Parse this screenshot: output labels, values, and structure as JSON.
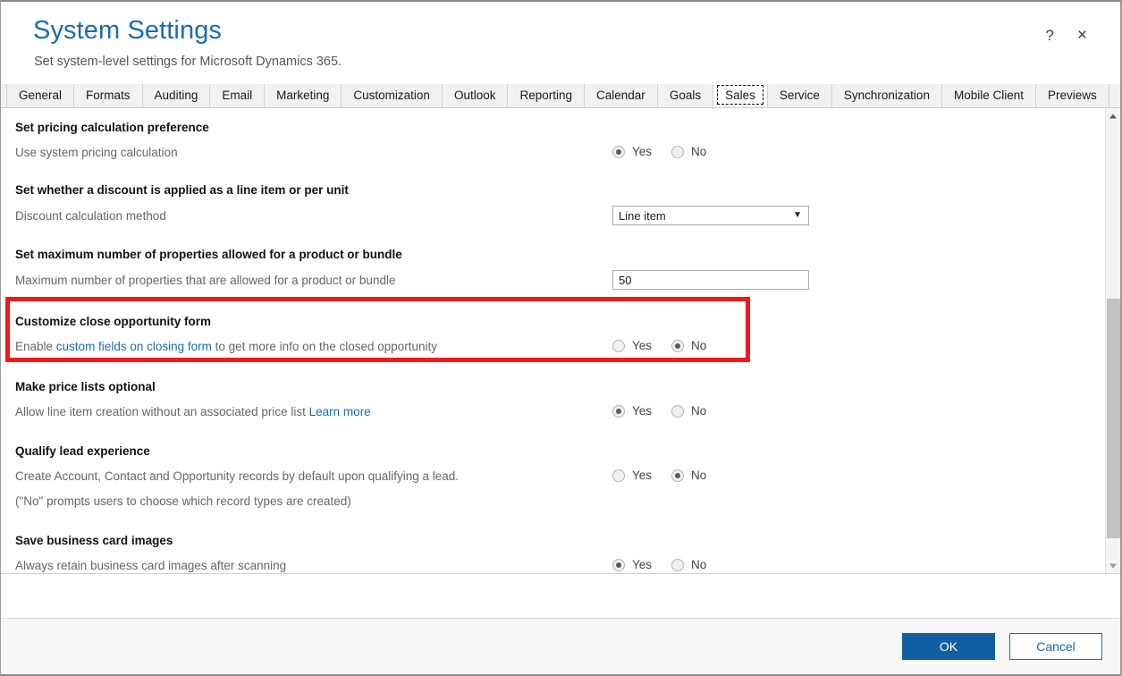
{
  "window": {
    "title": "System Settings",
    "subtitle": "Set system-level settings for Microsoft Dynamics 365.",
    "help_icon": "?",
    "close_icon": "×"
  },
  "colors": {
    "title_blue": "#1a6bb5",
    "link_blue": "#1a6bb5",
    "primary_button": "#115ea3",
    "highlight_red": "#ee1b1b"
  },
  "tabs": [
    {
      "label": "General",
      "active": false
    },
    {
      "label": "Formats",
      "active": false
    },
    {
      "label": "Auditing",
      "active": false
    },
    {
      "label": "Email",
      "active": false
    },
    {
      "label": "Marketing",
      "active": false
    },
    {
      "label": "Customization",
      "active": false
    },
    {
      "label": "Outlook",
      "active": false
    },
    {
      "label": "Reporting",
      "active": false
    },
    {
      "label": "Calendar",
      "active": false
    },
    {
      "label": "Goals",
      "active": false
    },
    {
      "label": "Sales",
      "active": true
    },
    {
      "label": "Service",
      "active": false
    },
    {
      "label": "Synchronization",
      "active": false
    },
    {
      "label": "Mobile Client",
      "active": false
    },
    {
      "label": "Previews",
      "active": false
    }
  ],
  "radio_options": {
    "yes": "Yes",
    "no": "No"
  },
  "sections": {
    "pricing": {
      "title": "Set pricing calculation preference",
      "description": "Use system pricing calculation",
      "selected": "Yes"
    },
    "discount": {
      "title": "Set whether a discount is applied as a line item or per unit",
      "description": "Discount calculation method",
      "dropdown_value": "Line item",
      "dropdown_caret": "▼"
    },
    "max_properties": {
      "title": "Set maximum number of properties allowed for a product or bundle",
      "description": "Maximum number of properties that are allowed for a product or bundle",
      "value": "50"
    },
    "close_opportunity": {
      "title": "Customize close opportunity form",
      "description_before": "Enable ",
      "description_link": "custom fields on closing form",
      "description_after": " to get more info on the closed opportunity",
      "selected": "No",
      "highlighted": true
    },
    "price_lists": {
      "title": "Make price lists optional",
      "description_before": "Allow line item creation without an associated price list ",
      "description_link": "Learn more",
      "selected": "Yes"
    },
    "qualify_lead": {
      "title": "Qualify lead experience",
      "description": "Create Account, Contact and Opportunity records by default upon qualifying a lead.",
      "description2": "(\"No\" prompts users to choose which record types are created)",
      "selected": "No"
    },
    "business_card": {
      "title": "Save business card images",
      "description": "Always retain business card images after scanning",
      "selected": "Yes"
    }
  },
  "scrollbar": {
    "up_arrow": "▲",
    "down_arrow": "▼"
  },
  "footer": {
    "ok_label": "OK",
    "cancel_label": "Cancel"
  }
}
